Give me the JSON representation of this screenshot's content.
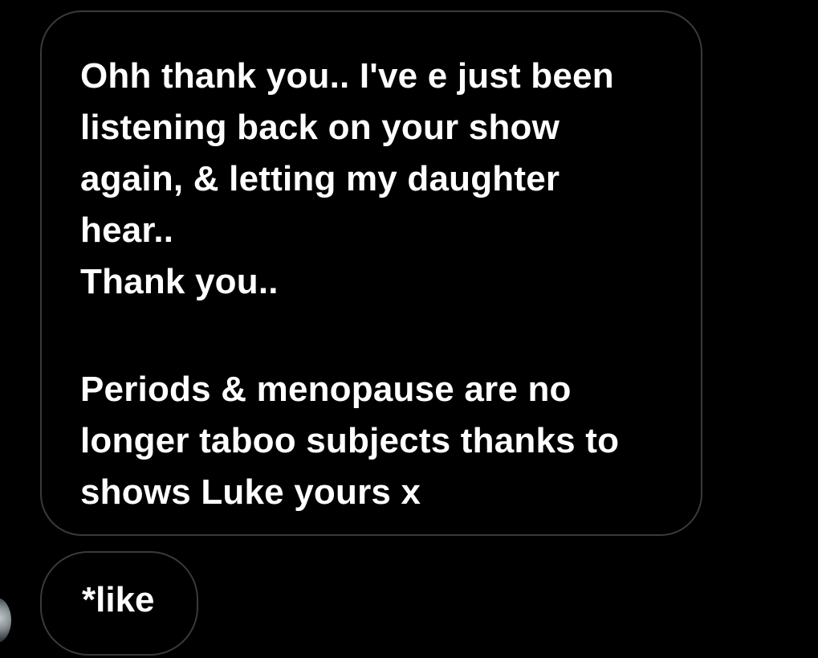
{
  "messages": [
    {
      "id": "msg1",
      "paragraphs": [
        "Ohh thank you.. I've e just been\nlistening back on your show\nagain, & letting my daughter\nhear..\nThank you..",
        "Periods & menopause are no\nlonger taboo subjects thanks to\nshows Luke yours x"
      ]
    },
    {
      "id": "msg2",
      "text": "*like"
    }
  ],
  "colors": {
    "background": "#000000",
    "bubble_border": "#3a3a3c",
    "text": "#ffffff"
  },
  "icons": {
    "avatar": "sender-avatar"
  }
}
